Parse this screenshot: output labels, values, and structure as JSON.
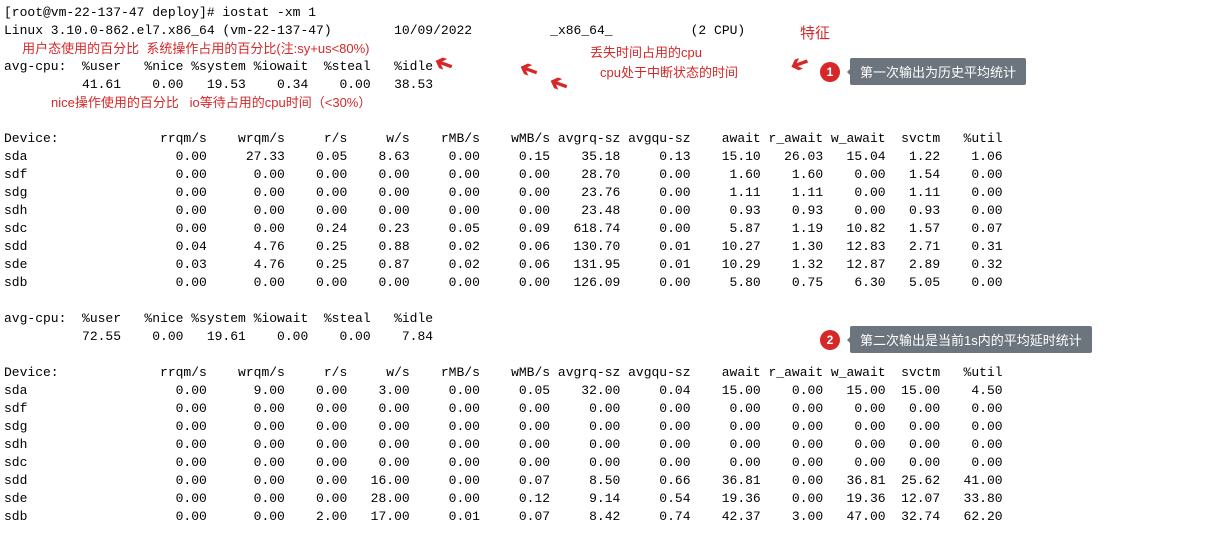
{
  "prompt": "[root@vm-22-137-47 deploy]# iostat -xm 1",
  "sysline_a": "Linux 3.10.0-862.el7.x86_64 (vm-22-137-47)",
  "sysline_date": "10/09/2022",
  "sysline_arch": "_x86_64_",
  "sysline_cpu": "(2 CPU)",
  "feature_label": "特征",
  "ann_user": "用户态使用的百分比",
  "ann_system": "系统操作占用的百分比(注:sy+us<80%)",
  "ann_steal": "丢失时间占用的cpu",
  "ann_idle": "cpu处于中断状态的时间",
  "ann_nice": "nice操作使用的百分比",
  "ann_iowait": "io等待占用的cpu时间（<30%）",
  "callout1": "第一次输出为历史平均统计",
  "callout2": "第二次输出是当前1s内的平均延时统计",
  "cpu_header": "avg-cpu:  %user   %nice %system %iowait  %steal   %idle",
  "cpu1": {
    "user": "41.61",
    "nice": "0.00",
    "system": "19.53",
    "iowait": "0.34",
    "steal": "0.00",
    "idle": "38.53"
  },
  "cpu2": {
    "user": "72.55",
    "nice": "0.00",
    "system": "19.61",
    "iowait": "0.00",
    "steal": "0.00",
    "idle": "7.84"
  },
  "dev_header": [
    "Device:",
    "rrqm/s",
    "wrqm/s",
    "r/s",
    "w/s",
    "rMB/s",
    "wMB/s",
    "avgrq-sz",
    "avgqu-sz",
    "await",
    "r_await",
    "w_await",
    "svctm",
    "%util"
  ],
  "block1": [
    {
      "d": "sda",
      "v": [
        "0.00",
        "27.33",
        "0.05",
        "8.63",
        "0.00",
        "0.15",
        "35.18",
        "0.13",
        "15.10",
        "26.03",
        "15.04",
        "1.22",
        "1.06"
      ]
    },
    {
      "d": "sdf",
      "v": [
        "0.00",
        "0.00",
        "0.00",
        "0.00",
        "0.00",
        "0.00",
        "28.70",
        "0.00",
        "1.60",
        "1.60",
        "0.00",
        "1.54",
        "0.00"
      ]
    },
    {
      "d": "sdg",
      "v": [
        "0.00",
        "0.00",
        "0.00",
        "0.00",
        "0.00",
        "0.00",
        "23.76",
        "0.00",
        "1.11",
        "1.11",
        "0.00",
        "1.11",
        "0.00"
      ]
    },
    {
      "d": "sdh",
      "v": [
        "0.00",
        "0.00",
        "0.00",
        "0.00",
        "0.00",
        "0.00",
        "23.48",
        "0.00",
        "0.93",
        "0.93",
        "0.00",
        "0.93",
        "0.00"
      ]
    },
    {
      "d": "sdc",
      "v": [
        "0.00",
        "0.00",
        "0.24",
        "0.23",
        "0.05",
        "0.09",
        "618.74",
        "0.00",
        "5.87",
        "1.19",
        "10.82",
        "1.57",
        "0.07"
      ]
    },
    {
      "d": "sdd",
      "v": [
        "0.04",
        "4.76",
        "0.25",
        "0.88",
        "0.02",
        "0.06",
        "130.70",
        "0.01",
        "10.27",
        "1.30",
        "12.83",
        "2.71",
        "0.31"
      ]
    },
    {
      "d": "sde",
      "v": [
        "0.03",
        "4.76",
        "0.25",
        "0.87",
        "0.02",
        "0.06",
        "131.95",
        "0.01",
        "10.29",
        "1.32",
        "12.87",
        "2.89",
        "0.32"
      ]
    },
    {
      "d": "sdb",
      "v": [
        "0.00",
        "0.00",
        "0.00",
        "0.00",
        "0.00",
        "0.00",
        "126.09",
        "0.00",
        "5.80",
        "0.75",
        "6.30",
        "5.05",
        "0.00"
      ]
    }
  ],
  "block2": [
    {
      "d": "sda",
      "v": [
        "0.00",
        "9.00",
        "0.00",
        "3.00",
        "0.00",
        "0.05",
        "32.00",
        "0.04",
        "15.00",
        "0.00",
        "15.00",
        "15.00",
        "4.50"
      ]
    },
    {
      "d": "sdf",
      "v": [
        "0.00",
        "0.00",
        "0.00",
        "0.00",
        "0.00",
        "0.00",
        "0.00",
        "0.00",
        "0.00",
        "0.00",
        "0.00",
        "0.00",
        "0.00"
      ]
    },
    {
      "d": "sdg",
      "v": [
        "0.00",
        "0.00",
        "0.00",
        "0.00",
        "0.00",
        "0.00",
        "0.00",
        "0.00",
        "0.00",
        "0.00",
        "0.00",
        "0.00",
        "0.00"
      ]
    },
    {
      "d": "sdh",
      "v": [
        "0.00",
        "0.00",
        "0.00",
        "0.00",
        "0.00",
        "0.00",
        "0.00",
        "0.00",
        "0.00",
        "0.00",
        "0.00",
        "0.00",
        "0.00"
      ]
    },
    {
      "d": "sdc",
      "v": [
        "0.00",
        "0.00",
        "0.00",
        "0.00",
        "0.00",
        "0.00",
        "0.00",
        "0.00",
        "0.00",
        "0.00",
        "0.00",
        "0.00",
        "0.00"
      ]
    },
    {
      "d": "sdd",
      "v": [
        "0.00",
        "0.00",
        "0.00",
        "16.00",
        "0.00",
        "0.07",
        "8.50",
        "0.66",
        "36.81",
        "0.00",
        "36.81",
        "25.62",
        "41.00"
      ]
    },
    {
      "d": "sde",
      "v": [
        "0.00",
        "0.00",
        "0.00",
        "28.00",
        "0.00",
        "0.12",
        "9.14",
        "0.54",
        "19.36",
        "0.00",
        "19.36",
        "12.07",
        "33.80"
      ]
    },
    {
      "d": "sdb",
      "v": [
        "0.00",
        "0.00",
        "2.00",
        "17.00",
        "0.01",
        "0.07",
        "8.42",
        "0.74",
        "42.37",
        "3.00",
        "47.00",
        "32.74",
        "62.20"
      ]
    }
  ]
}
